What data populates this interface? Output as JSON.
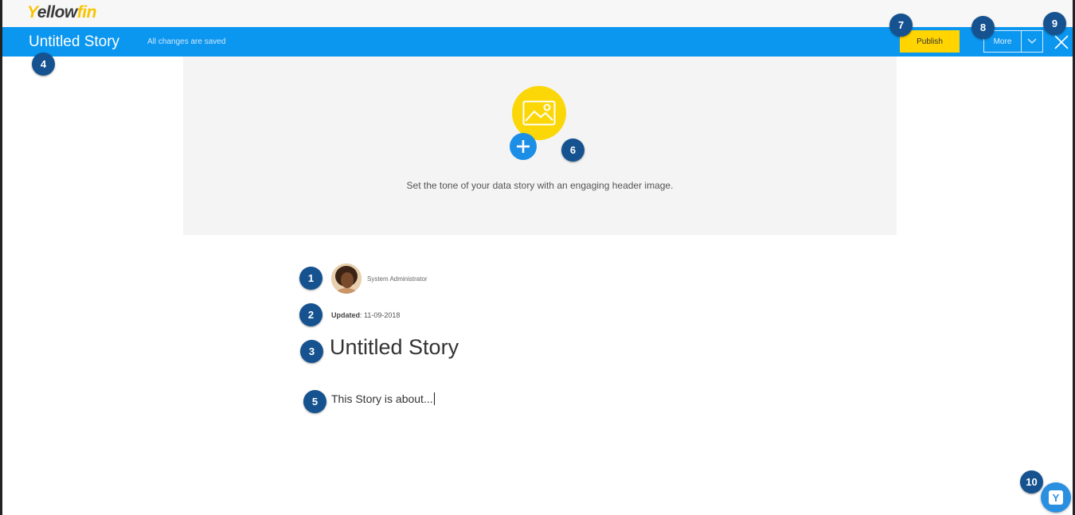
{
  "app": {
    "logo_text_1": "ellow",
    "logo_text_2": "fin",
    "logo_initial": "Y"
  },
  "toolbar": {
    "story_title": "Untitled Story",
    "save_status": "All changes are saved",
    "publish_label": "Publish",
    "more_label": "More"
  },
  "header_image": {
    "hint": "Set the tone of your data story with an engaging header image."
  },
  "story": {
    "author": "System Administrator",
    "updated_label": "Updated",
    "updated_date": ": 11-09-2018",
    "title": "Untitled Story",
    "body": "This Story is about..."
  },
  "callouts": [
    "1",
    "2",
    "3",
    "4",
    "5",
    "6",
    "7",
    "8",
    "9",
    "10"
  ],
  "help_button": {
    "letter": "Y"
  },
  "colors": {
    "brand_blue": "#0b96f0",
    "brand_yellow": "#ffd400",
    "callout_navy": "#15528f"
  },
  "icons": {
    "image": "image-icon",
    "add": "plus-icon",
    "dropdown": "chevron-down-icon",
    "close": "close-icon"
  }
}
